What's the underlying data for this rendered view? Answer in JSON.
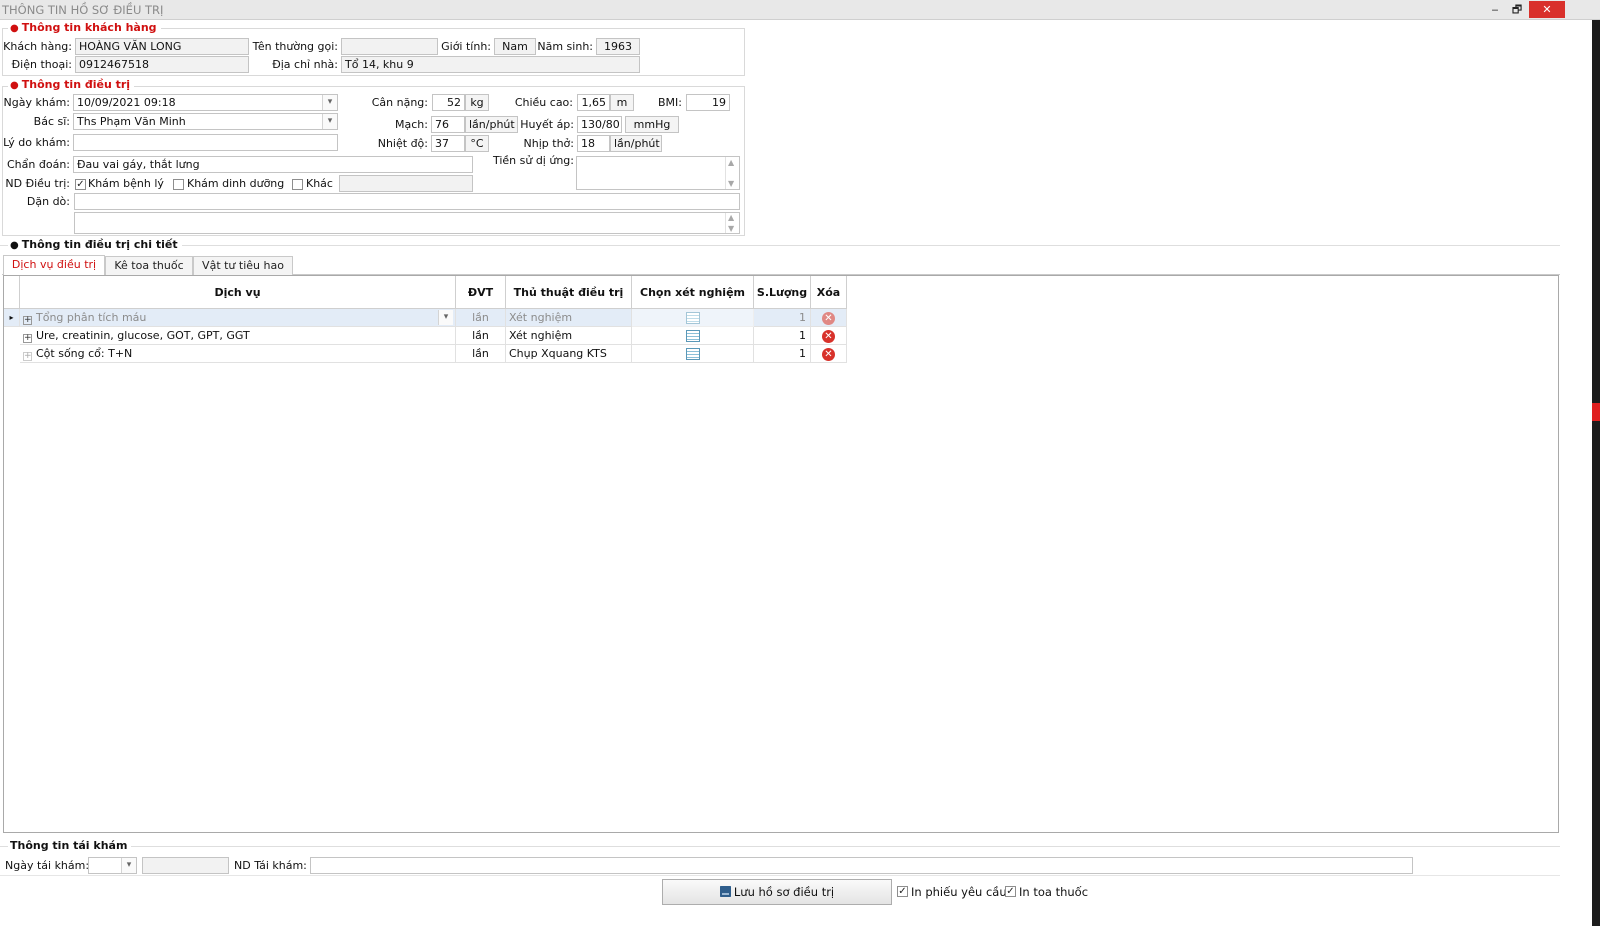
{
  "window": {
    "title": "THÔNG TIN HỒ SƠ ĐIỀU TRỊ",
    "minimize": "‒",
    "restore": "🗗",
    "close": "✕"
  },
  "customer": {
    "section_title": "Thông tin khách hàng",
    "name_label": "Khách hàng:",
    "name": "HOÀNG VĂN LONG",
    "nickname_label": "Tên thường gọi:",
    "nickname": "",
    "gender_label": "Giới tính:",
    "gender": "Nam",
    "birth_year_label": "Năm sinh:",
    "birth_year": "1963",
    "phone_label": "Điện thoại:",
    "phone": "0912467518",
    "address_label": "Địa chỉ nhà:",
    "address": "Tổ 14, khu 9"
  },
  "treatment": {
    "section_title": "Thông tin điều trị",
    "exam_date_label": "Ngày khám:",
    "exam_date": "10/09/2021 09:18",
    "doctor_label": "Bác sĩ:",
    "doctor": "Ths Phạm Văn Minh",
    "reason_label": "Lý do khám:",
    "reason": "",
    "weight_label": "Cân nặng:",
    "weight": "52",
    "weight_unit": "kg",
    "height_label": "Chiều cao:",
    "height": "1,65",
    "height_unit": "m",
    "bmi_label": "BMI:",
    "bmi": "19",
    "pulse_label": "Mạch:",
    "pulse": "76",
    "pulse_unit": "lần/phút",
    "bp_label": "Huyết áp:",
    "bp": "130/80",
    "bp_unit": "mmHg",
    "temp_label": "Nhiệt độ:",
    "temp": "37",
    "temp_unit": "°C",
    "breath_label": "Nhịp thở:",
    "breath": "18",
    "breath_unit": "lần/phút",
    "allergy_label": "Tiền sử dị ứng:",
    "allergy": "",
    "diagnosis_label": "Chẩn đoán:",
    "diagnosis": "Đau vai gáy, thắt lưng",
    "content_label": "ND Điều trị:",
    "content_options": [
      {
        "label": "Khám bệnh lý",
        "checked": true
      },
      {
        "label": "Khám dinh dưỡng",
        "checked": false
      },
      {
        "label": "Khác",
        "checked": false
      }
    ],
    "other_text": "",
    "advice_label": "Dặn dò:",
    "advice": "",
    "advice_more": ""
  },
  "detail": {
    "section_title": "Thông tin điều trị chi tiết",
    "tabs": [
      {
        "label": "Dịch vụ điều trị",
        "active": true
      },
      {
        "label": "Kê toa thuốc",
        "active": false
      },
      {
        "label": "Vật tư tiêu hao",
        "active": false
      }
    ],
    "columns": [
      "Dịch vụ",
      "ĐVT",
      "Thủ thuật điều trị",
      "Chọn xét nghiệm",
      "S.Lượng",
      "Xóa"
    ],
    "rows": [
      {
        "service": "Tổng phân tích máu",
        "unit": "lần",
        "procedure": "Xét nghiệm",
        "qty": "1",
        "selected": true
      },
      {
        "service": "Ure, creatinin, glucose, GOT, GPT, GGT",
        "unit": "lần",
        "procedure": "Xét nghiệm",
        "qty": "1",
        "selected": false
      },
      {
        "service": "Cột sống cổ: T+N",
        "unit": "lần",
        "procedure": "Chụp Xquang KTS",
        "qty": "1",
        "selected": false
      }
    ]
  },
  "followup": {
    "section_title": "Thông tin tái khám",
    "date_label": "Ngày tái khám:",
    "date": "",
    "date_text": "",
    "content_label": "ND Tái khám:",
    "content": ""
  },
  "footer": {
    "save_label": "Lưu hồ sơ điều trị",
    "print_request_label": "In phiếu yêu cầu",
    "print_request_checked": true,
    "print_rx_label": "In toa thuốc",
    "print_rx_checked": true
  }
}
